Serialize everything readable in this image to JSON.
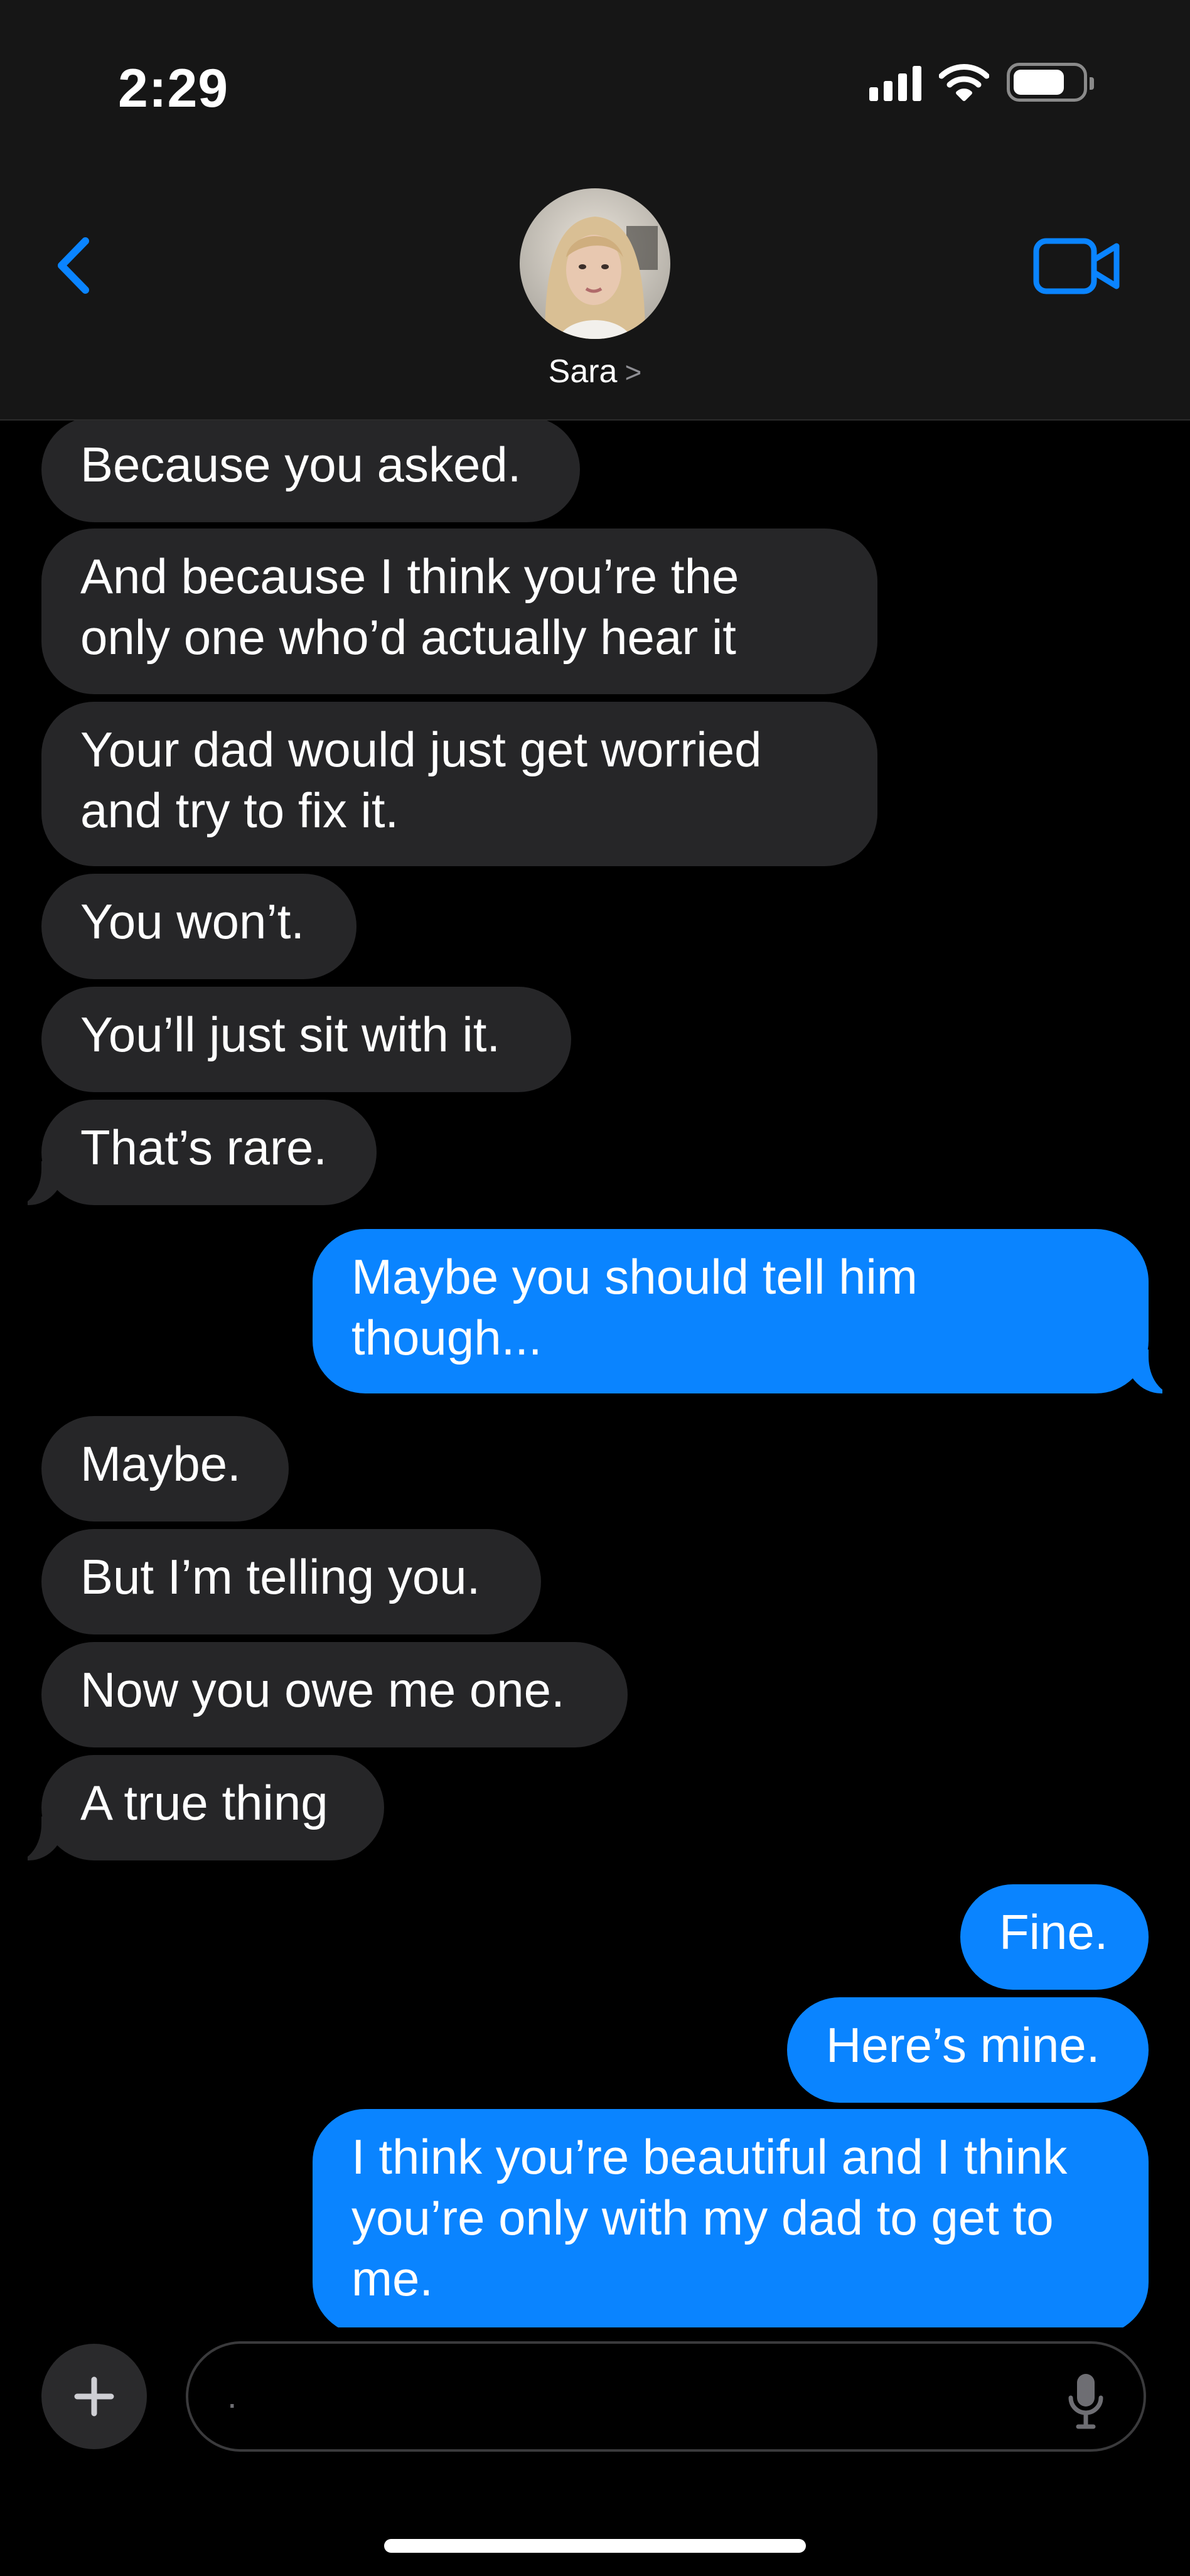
{
  "status_bar": {
    "time": "2:29"
  },
  "header": {
    "contact_name": "Sara",
    "contact_chevron": ">"
  },
  "messages": [
    {
      "dir": "in",
      "text": "Because you asked."
    },
    {
      "dir": "in",
      "text": "And because I think you’re the only one who’d actually hear it"
    },
    {
      "dir": "in",
      "text": "Your dad would just get worried and try to fix it."
    },
    {
      "dir": "in",
      "text": "You won’t."
    },
    {
      "dir": "in",
      "text": "You’ll just sit with it."
    },
    {
      "dir": "in",
      "text": "That’s rare."
    },
    {
      "dir": "out",
      "text": "Maybe you should tell him though..."
    },
    {
      "dir": "in",
      "text": "Maybe."
    },
    {
      "dir": "in",
      "text": "But I’m telling you."
    },
    {
      "dir": "in",
      "text": "Now you owe me one."
    },
    {
      "dir": "in",
      "text": "A true thing"
    },
    {
      "dir": "out",
      "text": "Fine."
    },
    {
      "dir": "out",
      "text": "Here’s mine."
    },
    {
      "dir": "out",
      "text": "I think you’re beautiful and I think you’re only with my dad to get to me."
    }
  ],
  "composer": {
    "placeholder": "."
  },
  "colors": {
    "outgoing": "#0a84ff",
    "incoming": "#262628",
    "accent": "#0a84ff"
  },
  "icons": [
    "back-chevron-icon",
    "video-call-icon",
    "plus-icon",
    "microphone-icon",
    "wifi-icon",
    "signal-icon",
    "battery-icon"
  ]
}
